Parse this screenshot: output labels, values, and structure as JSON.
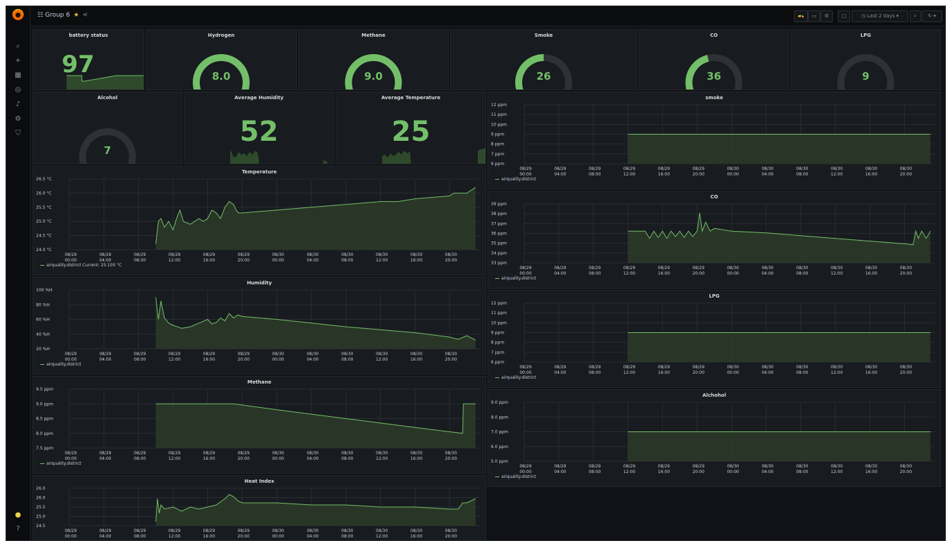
{
  "topbar": {
    "dashboard_title": "Group 6",
    "time_range": "Last 2 days",
    "buttons": [
      "add-panel",
      "save",
      "settings",
      "tv-mode",
      "zoom-out",
      "refresh"
    ]
  },
  "sidebar": {
    "icons": [
      "search-icon",
      "plus-icon",
      "dashboards-icon",
      "explore-icon",
      "alert-icon",
      "gear-icon",
      "shield-icon"
    ],
    "bottom_icons": [
      "user-icon",
      "help-icon"
    ]
  },
  "stats": {
    "battery": {
      "title": "battery status",
      "value": "97"
    },
    "humidity": {
      "title": "Average Humidity",
      "value": "52"
    },
    "temperature": {
      "title": "Average Temperature",
      "value": "25"
    }
  },
  "gauges": [
    {
      "key": "hydrogen",
      "title": "Hydrogen",
      "value": "8.0",
      "fraction": 1.0
    },
    {
      "key": "methane",
      "title": "Methane",
      "value": "9.0",
      "fraction": 1.0
    },
    {
      "key": "smoke",
      "title": "Smoke",
      "value": "26",
      "fraction": 0.5
    },
    {
      "key": "co",
      "title": "CO",
      "value": "36",
      "fraction": 0.45
    },
    {
      "key": "lpg",
      "title": "LPG",
      "value": "9",
      "fraction": 0.0
    },
    {
      "key": "alcohol",
      "title": "Alcohol",
      "value": "7",
      "fraction": 0.0
    }
  ],
  "colors": {
    "series": "#73bf69",
    "fill": "#2b3a28",
    "grid": "#2a2d33"
  },
  "x_ticks": [
    [
      "08/29",
      "00:00"
    ],
    [
      "08/29",
      "04:00"
    ],
    [
      "08/29",
      "08:00"
    ],
    [
      "08/29",
      "12:00"
    ],
    [
      "08/29",
      "16:00"
    ],
    [
      "08/29",
      "20:00"
    ],
    [
      "08/30",
      "00:00"
    ],
    [
      "08/30",
      "04:00"
    ],
    [
      "08/30",
      "08:00"
    ],
    [
      "08/30",
      "12:00"
    ],
    [
      "08/30",
      "16:00"
    ],
    [
      "08/30",
      "20:00"
    ]
  ],
  "chart_data": [
    {
      "key": "temperature",
      "type": "area",
      "title": "Temperature",
      "legend": "airquality.district  Current: 25.100 °C",
      "yticks": [
        "26.5 °C",
        "26.0 °C",
        "25.5 °C",
        "25.0 °C",
        "24.5 °C",
        "24.0 °C"
      ],
      "ylim": [
        24.0,
        26.5
      ],
      "x": [
        10,
        10.3,
        10.6,
        11,
        11.5,
        12,
        12.4,
        12.8,
        13.2,
        14,
        14.5,
        15,
        15.5,
        16,
        16.5,
        17,
        17.5,
        18,
        18.5,
        19,
        19.3,
        19.6,
        20,
        24,
        28,
        32,
        36,
        38,
        40,
        44,
        44.5,
        45.5,
        46,
        46.5,
        47
      ],
      "y": [
        24.2,
        25.0,
        25.1,
        24.8,
        25.0,
        24.7,
        25.1,
        25.4,
        25.0,
        24.9,
        25.0,
        25.1,
        25.0,
        25.1,
        25.4,
        25.3,
        25.1,
        25.5,
        25.7,
        25.6,
        25.4,
        25.3,
        25.3,
        25.4,
        25.5,
        25.6,
        25.7,
        25.7,
        25.8,
        25.9,
        26.0,
        26.0,
        26.0,
        26.1,
        26.2
      ]
    },
    {
      "key": "humidity",
      "type": "area",
      "title": "Humidity",
      "legend": "airquality.district",
      "yticks": [
        "100 %H",
        "80 %H",
        "60 %H",
        "40 %H",
        "20 %H"
      ],
      "ylim": [
        20,
        100
      ],
      "x": [
        10,
        10.3,
        10.6,
        11,
        11.5,
        12,
        13,
        14,
        15,
        16,
        16.5,
        17,
        17.5,
        18,
        18.5,
        19,
        19.5,
        20,
        24,
        28,
        32,
        36,
        40,
        44,
        45,
        46,
        47
      ],
      "y": [
        90,
        60,
        85,
        62,
        55,
        52,
        48,
        50,
        55,
        60,
        54,
        56,
        62,
        58,
        68,
        62,
        66,
        64,
        60,
        55,
        50,
        46,
        42,
        36,
        33,
        38,
        32
      ]
    },
    {
      "key": "methane",
      "type": "area",
      "title": "Methane",
      "legend": "airquality.district",
      "yticks": [
        "9.5 ppm",
        "9.0 ppm",
        "8.5 ppm",
        "8.0 ppm",
        "7.5 ppm"
      ],
      "ylim": [
        7.5,
        9.5
      ],
      "x": [
        10,
        14,
        19,
        24,
        28,
        32,
        36,
        40,
        45.5,
        45.6,
        47
      ],
      "y": [
        9.0,
        9.0,
        9.0,
        8.8,
        8.65,
        8.5,
        8.35,
        8.2,
        8.0,
        9.0,
        9.0
      ]
    },
    {
      "key": "heatindex",
      "type": "area",
      "title": "Heat Index",
      "legend": "",
      "yticks": [
        "26.0",
        "26.0",
        "25.5",
        "25.0",
        "24.5"
      ],
      "ylim": [
        24.4,
        26.2
      ],
      "x": [
        10,
        10.2,
        10.4,
        10.6,
        11,
        12,
        13,
        14,
        15,
        16,
        17,
        18,
        18.5,
        19,
        19.5,
        20,
        24,
        28,
        32,
        36,
        40,
        44,
        45,
        45.5,
        46,
        46.5,
        47
      ],
      "y": [
        24.6,
        25.7,
        25.0,
        25.4,
        25.2,
        25.3,
        25.1,
        25.3,
        25.2,
        25.3,
        25.4,
        25.7,
        25.9,
        25.8,
        25.6,
        25.5,
        25.5,
        25.4,
        25.4,
        25.3,
        25.3,
        25.2,
        25.2,
        25.5,
        25.5,
        25.6,
        25.7
      ]
    },
    {
      "key": "smoke",
      "type": "area",
      "title": "smoke",
      "legend": "airquality.district",
      "yticks": [
        "12 ppm",
        "11 ppm",
        "10 ppm",
        "9 ppm",
        "8 ppm",
        "7 ppm",
        "6 ppm"
      ],
      "ylim": [
        6,
        12
      ],
      "x": [
        12,
        47
      ],
      "y": [
        9,
        9
      ]
    },
    {
      "key": "co",
      "type": "area",
      "title": "CO",
      "legend": "airquality.district",
      "yticks": [
        "39 ppm",
        "38 ppm",
        "37 ppm",
        "36 ppm",
        "35 ppm",
        "34 ppm",
        "33 ppm"
      ],
      "ylim": [
        32.5,
        39
      ],
      "x": [
        12,
        14,
        14.5,
        15,
        15.5,
        16,
        16.5,
        17,
        17.5,
        18,
        18.5,
        19,
        19.5,
        20,
        20.3,
        20.6,
        21,
        21.5,
        22,
        24,
        28,
        32,
        36,
        40,
        44,
        45,
        45.3,
        45.6,
        46,
        46.5,
        47
      ],
      "y": [
        36,
        36,
        35.2,
        36,
        35.3,
        36,
        35.2,
        36,
        35.4,
        36,
        35.3,
        36,
        35.4,
        36,
        38,
        36,
        37,
        36,
        36.3,
        36,
        35.8,
        35.5,
        35.2,
        34.9,
        34.6,
        34.5,
        36,
        35.2,
        36,
        35.2,
        36
      ]
    },
    {
      "key": "lpg",
      "type": "area",
      "title": "LPG",
      "legend": "airquality.district",
      "yticks": [
        "12 ppm",
        "11 ppm",
        "10 ppm",
        "9 ppm",
        "8 ppm",
        "7 ppm",
        "6 ppm"
      ],
      "ylim": [
        6,
        12
      ],
      "x": [
        12,
        47
      ],
      "y": [
        9,
        9
      ]
    },
    {
      "key": "alcohol",
      "type": "area",
      "title": "Alchohol",
      "legend": "airquality.district",
      "yticks": [
        "9.0 ppm",
        "8.0 ppm",
        "7.0 ppm",
        "6.0 ppm",
        "5.0 ppm"
      ],
      "ylim": [
        5,
        9
      ],
      "x": [
        12,
        47
      ],
      "y": [
        7,
        7
      ]
    }
  ]
}
